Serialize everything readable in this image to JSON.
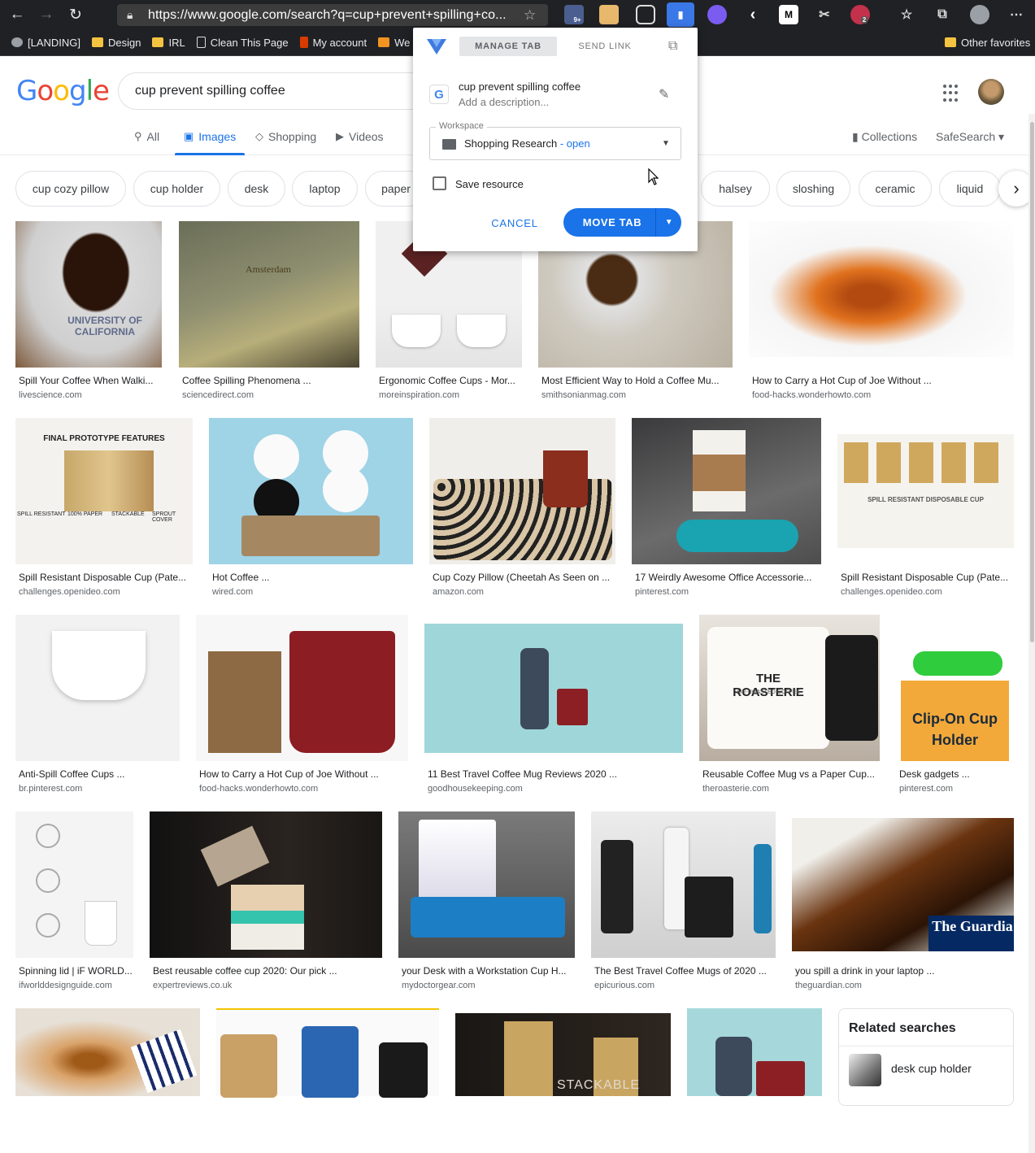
{
  "browser": {
    "url": "https://www.google.com/search?q=cup+prevent+spilling+co...",
    "extension_badges": {
      "first": "9+",
      "second": "2"
    },
    "bookmarks": [
      "[LANDING]",
      "Design",
      "IRL",
      "Clean This Page",
      "My account",
      "We"
    ],
    "other_favorites": "Other favorites"
  },
  "google": {
    "logo": "Google",
    "query": "cup prevent spilling coffee",
    "tabs": [
      "All",
      "Images",
      "Shopping",
      "Videos"
    ],
    "active_tab": "Images",
    "collections": "Collections",
    "safesearch": "SafeSearch"
  },
  "chips": [
    "cup cozy pillow",
    "cup holder",
    "desk",
    "laptop",
    "paper",
    "halsey",
    "sloshing",
    "ceramic",
    "liquid"
  ],
  "results": [
    {
      "title": "Spill Your Coffee When Walki...",
      "source": "livescience.com"
    },
    {
      "title": "Coffee Spilling Phenomena ...",
      "source": "sciencedirect.com"
    },
    {
      "title": "Ergonomic Coffee Cups - Mor...",
      "source": "moreinspiration.com"
    },
    {
      "title": "Most Efficient Way to Hold a Coffee Mu...",
      "source": "smithsonianmag.com"
    },
    {
      "title": "How to Carry a Hot Cup of Joe Without ...",
      "source": "food-hacks.wonderhowto.com"
    },
    {
      "title": "Spill Resistant Disposable Cup (Pate...",
      "source": "challenges.openideo.com"
    },
    {
      "title": "Hot Coffee ...",
      "source": "wired.com"
    },
    {
      "title": "Cup Cozy Pillow (Cheetah As Seen on ...",
      "source": "amazon.com"
    },
    {
      "title": "17 Weirdly Awesome Office Accessorie...",
      "source": "pinterest.com"
    },
    {
      "title": "Spill Resistant Disposable Cup (Pate...",
      "source": "challenges.openideo.com"
    },
    {
      "title": "Anti-Spill Coffee Cups ...",
      "source": "br.pinterest.com"
    },
    {
      "title": "How to Carry a Hot Cup of Joe Without ...",
      "source": "food-hacks.wonderhowto.com"
    },
    {
      "title": "11 Best Travel Coffee Mug Reviews 2020 ...",
      "source": "goodhousekeeping.com"
    },
    {
      "title": "Reusable Coffee Mug vs a Paper Cup...",
      "source": "theroasterie.com"
    },
    {
      "title": "Desk gadgets ...",
      "source": "pinterest.com"
    },
    {
      "title": "Spinning lid | iF WORLD...",
      "source": "ifworlddesignguide.com"
    },
    {
      "title": "Best reusable coffee cup 2020: Our pick ...",
      "source": "expertreviews.co.uk"
    },
    {
      "title": "your Desk with a Workstation Cup H...",
      "source": "mydoctorgear.com"
    },
    {
      "title": "The Best Travel Coffee Mugs of 2020 ...",
      "source": "epicurious.com"
    },
    {
      "title": "you spill a drink in your laptop ...",
      "source": "theguardian.com"
    }
  ],
  "image_overlays": {
    "uc": "UNIVERSITY OF CALIFORNIA",
    "amsterdam": "Amsterdam",
    "final_proto": "FINAL PROTOTYPE FEATURES",
    "proto_labels": [
      "SPILL RESISTANT",
      "100% PAPER",
      "STACKABLE",
      "SPROUT COVER"
    ],
    "spill_cup": "SPILL RESISTANT DISPOSABLE CUP",
    "roasterie": "THE ROASTERIE",
    "roasterie_sub": "AIR-ROASTED COFFEE",
    "clip_on": "Clip-On Cup Holder",
    "guardian": "The Guardia",
    "stackable": "STACKABLE"
  },
  "related": {
    "heading": "Related searches",
    "item": "desk cup holder"
  },
  "popup": {
    "tab_manage": "MANAGE TAB",
    "tab_send": "SEND LINK",
    "title": "cup prevent spilling coffee",
    "description_placeholder": "Add a description...",
    "workspace_label": "Workspace",
    "workspace_value": "Shopping Research",
    "workspace_status": "- open",
    "save_label": "Save resource",
    "cancel": "CANCEL",
    "move": "MOVE TAB"
  },
  "colors": {
    "brand_blue": "#1a73e8",
    "chrome_dark": "#202124"
  }
}
